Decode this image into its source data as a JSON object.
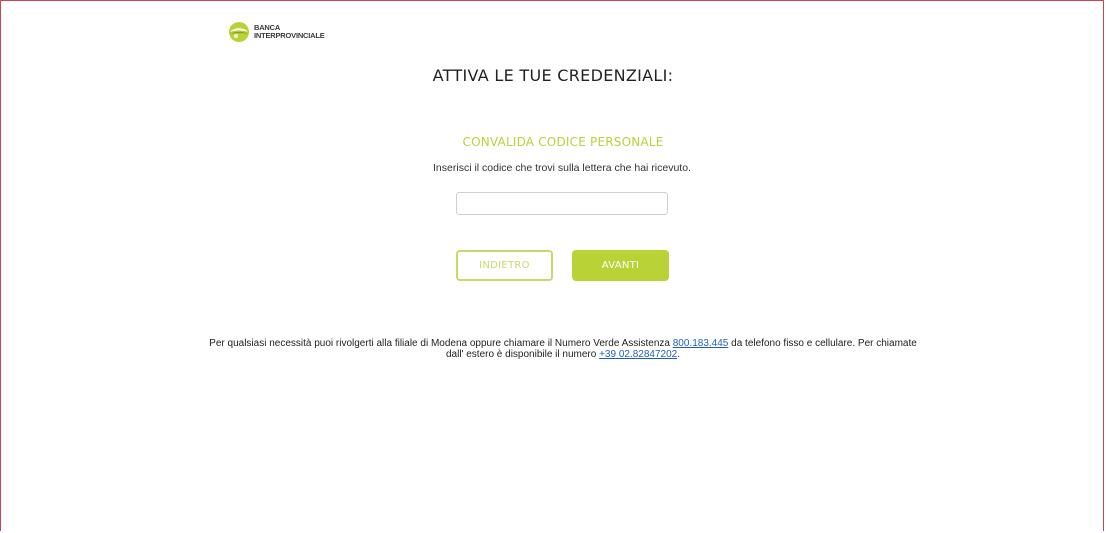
{
  "brand": {
    "line1": "BANCA",
    "line2": "INTERPROVINCIALE",
    "accent_color": "#b9d336"
  },
  "page": {
    "title": "ATTIVA LE TUE CREDENZIALI:",
    "subtitle": "CONVALIDA CODICE PERSONALE",
    "instruction": "Inserisci il codice che trovi sulla lettera che hai ricevuto."
  },
  "form": {
    "code_value": "",
    "code_placeholder": ""
  },
  "buttons": {
    "back_label": "INDIETRO",
    "next_label": "AVANTI"
  },
  "footer": {
    "text_before_phone": "Per qualsiasi necessità puoi rivolgerti alla filiale di Modena oppure chiamare il Numero Verde Assistenza ",
    "phone_toll_free": "800.183.445",
    "text_after_phone": " da telefono fisso e cellulare. Per chiamate dall' estero è disponibile il numero ",
    "phone_abroad": "+39 02.82847202",
    "text_end": "."
  }
}
